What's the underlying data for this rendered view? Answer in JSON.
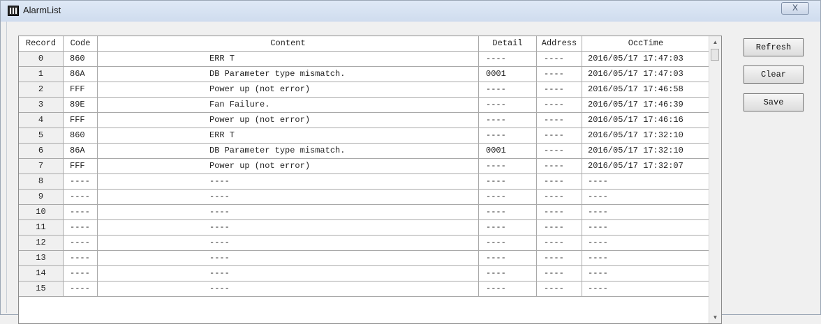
{
  "window": {
    "title": "AlarmList",
    "close_glyph": "X"
  },
  "table": {
    "columns": [
      "Record",
      "Code",
      "Content",
      "Detail",
      "Address",
      "OccTime"
    ],
    "rows": [
      [
        "0",
        "860",
        "ERR T",
        "----",
        "----",
        "2016/05/17 17:47:03"
      ],
      [
        "1",
        "86A",
        "DB Parameter type mismatch.",
        "0001",
        "----",
        "2016/05/17 17:47:03"
      ],
      [
        "2",
        "FFF",
        "Power up (not error)",
        "----",
        "----",
        "2016/05/17 17:46:58"
      ],
      [
        "3",
        "89E",
        "Fan Failure.",
        "----",
        "----",
        "2016/05/17 17:46:39"
      ],
      [
        "4",
        "FFF",
        "Power up (not error)",
        "----",
        "----",
        "2016/05/17 17:46:16"
      ],
      [
        "5",
        "860",
        "ERR T",
        "----",
        "----",
        "2016/05/17 17:32:10"
      ],
      [
        "6",
        "86A",
        "DB Parameter type mismatch.",
        "0001",
        "----",
        "2016/05/17 17:32:10"
      ],
      [
        "7",
        "FFF",
        "Power up (not error)",
        "----",
        "----",
        "2016/05/17 17:32:07"
      ],
      [
        "8",
        "----",
        "----",
        "----",
        "----",
        "----"
      ],
      [
        "9",
        "----",
        "----",
        "----",
        "----",
        "----"
      ],
      [
        "10",
        "----",
        "----",
        "----",
        "----",
        "----"
      ],
      [
        "11",
        "----",
        "----",
        "----",
        "----",
        "----"
      ],
      [
        "12",
        "----",
        "----",
        "----",
        "----",
        "----"
      ],
      [
        "13",
        "----",
        "----",
        "----",
        "----",
        "----"
      ],
      [
        "14",
        "----",
        "----",
        "----",
        "----",
        "----"
      ],
      [
        "15",
        "----",
        "----",
        "----",
        "----",
        "----"
      ]
    ]
  },
  "buttons": {
    "refresh": "Refresh",
    "clear": "Clear",
    "save": "Save"
  },
  "scrollbar": {
    "up_arrow": "▲",
    "down_arrow": "▼"
  },
  "icons": {
    "window": "app-grid-icon",
    "close": "close-icon"
  }
}
